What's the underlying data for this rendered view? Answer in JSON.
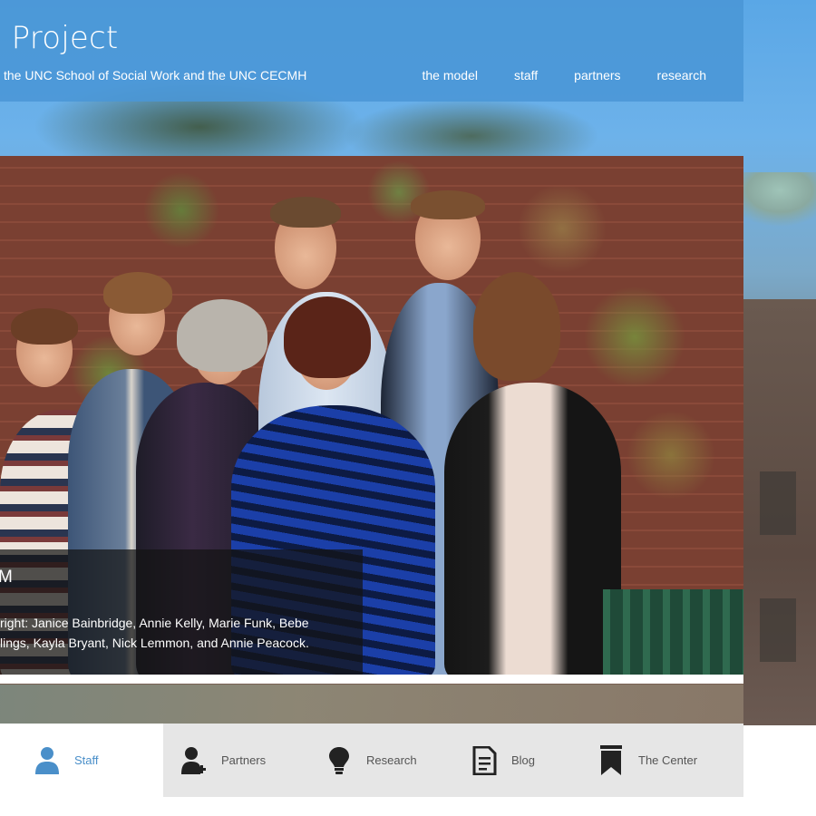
{
  "header": {
    "site_title": "l Project",
    "subtitle": "the UNC School of Social Work and the UNC CECMH",
    "nav": [
      {
        "label": "the model"
      },
      {
        "label": "staff"
      },
      {
        "label": "partners"
      },
      {
        "label": "research"
      }
    ]
  },
  "hero": {
    "caption_title": "M",
    "caption_lines": [
      "right: Janice Bainbridge, Annie Kelly, Marie Funk, Bebe",
      "lings, Kayla Bryant, Nick Lemmon, and Annie Peacock."
    ]
  },
  "tabs": [
    {
      "label": "Staff",
      "icon": "person-icon",
      "active": true
    },
    {
      "label": "Partners",
      "icon": "add-person-icon",
      "active": false
    },
    {
      "label": "Research",
      "icon": "lightbulb-icon",
      "active": false
    },
    {
      "label": "Blog",
      "icon": "document-icon",
      "active": false
    },
    {
      "label": "The Center",
      "icon": "bookmark-icon",
      "active": false
    }
  ],
  "colors": {
    "header_bg": "#4a96d6",
    "active_tab_text": "#4a8fc9",
    "tab_bar_bg": "#e6e6e6"
  }
}
